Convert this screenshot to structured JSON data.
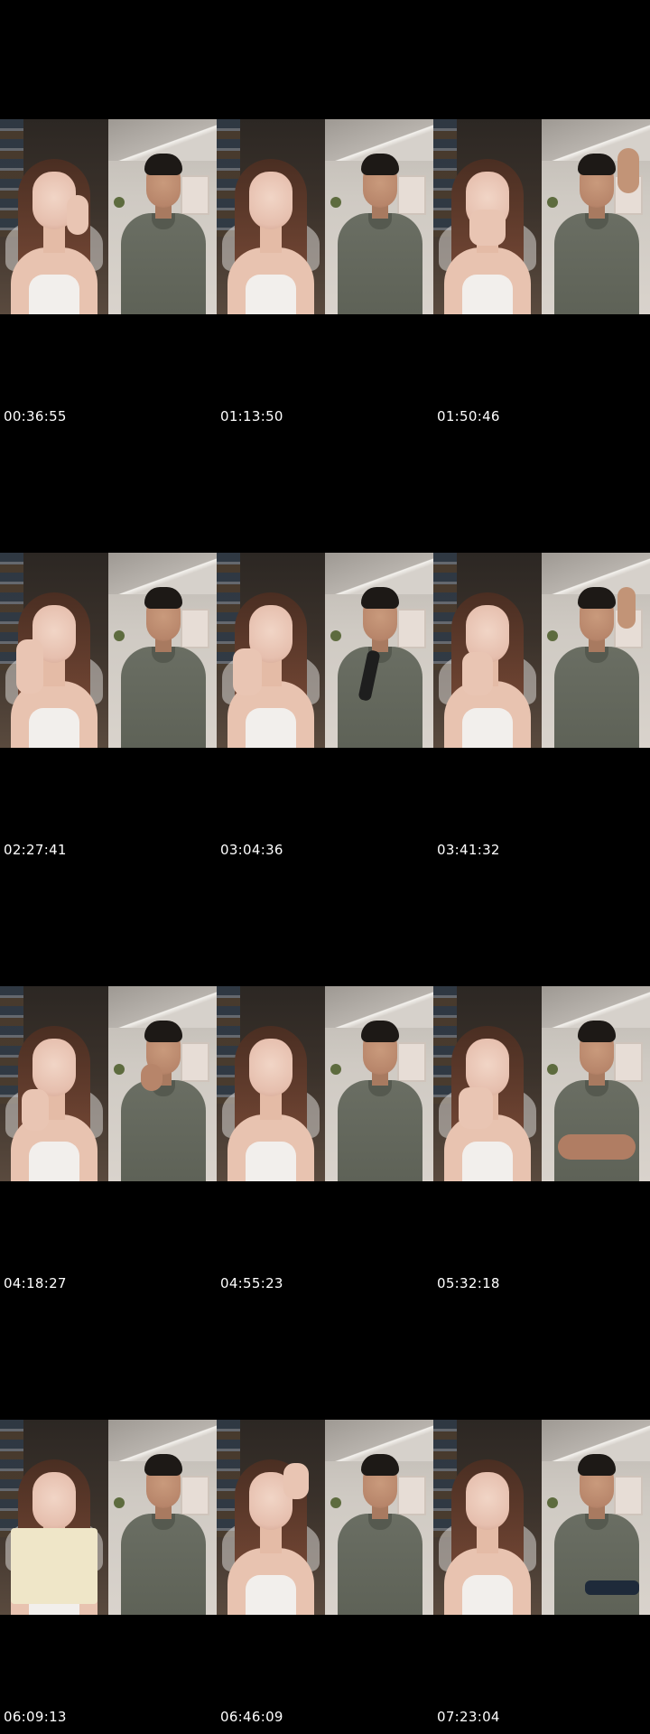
{
  "contact_sheet": {
    "timestamps": [
      "00:36:55",
      "01:13:50",
      "01:50:46",
      "02:27:41",
      "03:04:36",
      "03:41:32",
      "04:18:27",
      "04:55:23",
      "05:32:18",
      "06:09:13",
      "06:46:09",
      "07:23:04"
    ]
  },
  "colors": {
    "background": "#000000",
    "timestamp_text": "#ffffff",
    "shirt": "#62665b"
  }
}
